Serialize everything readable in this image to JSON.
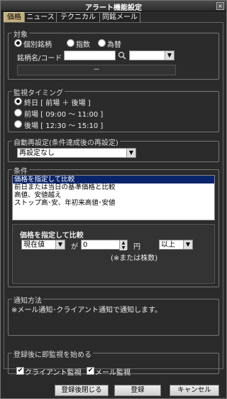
{
  "window": {
    "title": "アラート機能設定",
    "close_label": "×"
  },
  "tabs": [
    {
      "label": "価格",
      "active": true
    },
    {
      "label": "ニュース",
      "active": false
    },
    {
      "label": "テクニカル",
      "active": false
    },
    {
      "label": "同銘メール",
      "active": false
    }
  ],
  "target": {
    "legend": "対象",
    "options": [
      {
        "label": "個別銘柄",
        "selected": true
      },
      {
        "label": "指数",
        "selected": false
      },
      {
        "label": "為替",
        "selected": false
      }
    ],
    "code_label": "銘柄名/コード",
    "code_value": "",
    "market_value": "",
    "name_display": "－"
  },
  "timing": {
    "legend": "監視タイミング",
    "options": [
      {
        "label": "終日 [ 前場 ＋ 後場 ]",
        "selected": true
      },
      {
        "label": "前場 [ 09:00 ～ 11:00 ]",
        "selected": false
      },
      {
        "label": "後場 [ 12:30 ～ 15:10 ]",
        "selected": false
      }
    ]
  },
  "auto_reset": {
    "legend": "自動再設定(条件達成後の再設定)",
    "value": "再設定なし"
  },
  "condition": {
    "legend": "条件",
    "items": [
      "価格を指定して比較",
      "前日または当日の基準価格と比較",
      "高値、安値越え",
      "ストップ高･安、年初来高値･安値"
    ],
    "selected_index": 0,
    "detail_title": "価格を指定して比較",
    "base_value": "現在値",
    "particle": "が",
    "price_value": "0",
    "unit": "円",
    "compare_value": "以上",
    "note": "(※または株数)"
  },
  "notification": {
    "legend": "通知方法",
    "text": "※メール通知･クライアント通知で通知します。"
  },
  "start_monitor": {
    "legend": "登録後に即監視を始める",
    "client_label": "クライアント監視",
    "client_checked": true,
    "mail_label": "メール監視",
    "mail_checked": true
  },
  "buttons": {
    "register_close": "登録後閉じる",
    "register": "登録",
    "cancel": "キャンセル"
  }
}
